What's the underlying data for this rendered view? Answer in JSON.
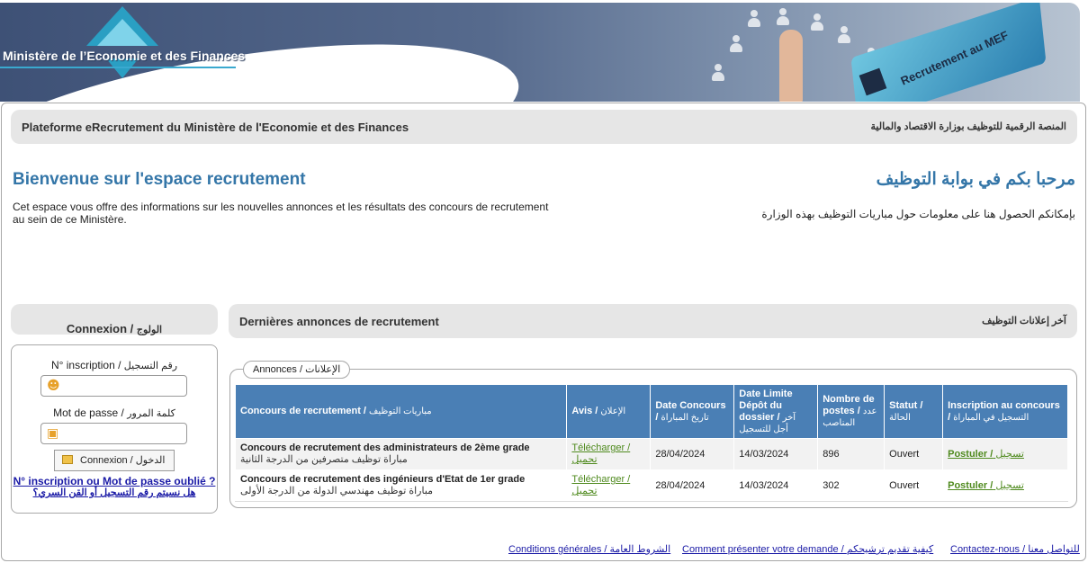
{
  "banner": {
    "ministry_name": "Ministère de l’Economie et des Finances",
    "card_text": "Recrutement au MEF"
  },
  "topbar": {
    "title_fr": "Plateforme eRecrutement du Ministère de l'Economie et des Finances",
    "title_ar": "المنصة الرقمية للتوظيف بوزارة الاقتصاد والمالية"
  },
  "welcome": {
    "title_fr": "Bienvenue sur l'espace recrutement",
    "title_ar": "مرحبا بكم في بوابة التوظيف",
    "text_fr": "Cet espace vous offre des informations sur les nouvelles annonces et les résultats des concours de recrutement au sein de ce Ministère.",
    "text_ar": "بإمكانكم الحصول هنا على معلومات حول مباريات التوظيف بهذه الوزارة"
  },
  "login": {
    "header_fr": "Connexion /",
    "header_ar": "الولوج",
    "inscription_label_fr": "N° inscription /",
    "inscription_label_ar": "رقم التسجيل",
    "inscription_value": "",
    "password_label_fr": "Mot de passe /",
    "password_label_ar": "كلمة المرور",
    "password_value": "",
    "button_fr": "Connexion /",
    "button_ar": "الدخول",
    "forgot_fr": "N° inscription ou Mot de passe oublié ?",
    "forgot_ar": "هل نسيتم رقم التسجيل أو القن السري؟",
    "user_icon": "user-icon",
    "lock_icon": "lock-icon"
  },
  "announcements": {
    "header_fr": "Dernières annonces de recrutement",
    "header_ar": "آخر إعلانات التوظيف",
    "legend": "Annonces / الإعلانات",
    "columns": [
      {
        "fr": "Concours de recrutement /",
        "ar": "مباريات التوظيف"
      },
      {
        "fr": "Avis /",
        "ar": "الإعلان"
      },
      {
        "fr": "Date Concours /",
        "ar": "تاريخ المباراة"
      },
      {
        "fr": "Date Limite Dépôt du dossier /",
        "ar": "آخر أجل للتسجيل"
      },
      {
        "fr": "Nombre de postes /",
        "ar": "عدد المناصب"
      },
      {
        "fr": "Statut /",
        "ar": "الحالة"
      },
      {
        "fr": "Inscription au concours /",
        "ar": "التسجيل في المباراة"
      }
    ],
    "rows": [
      {
        "title_fr": "Concours de recrutement des administrateurs de 2ème grade",
        "title_ar": "مباراة توظيف متصرفين من الدرجة الثانية",
        "avis_fr": "Télécharger /",
        "avis_ar": "تحميل",
        "date_concours": "28/04/2024",
        "date_limite": "14/03/2024",
        "postes": "896",
        "statut": "Ouvert",
        "inscription_fr": "Postuler /",
        "inscription_ar": "تسجيل"
      },
      {
        "title_fr": "Concours de recrutement des ingénieurs d'Etat de 1er grade",
        "title_ar": "مباراة توظيف مهندسي الدولة من الدرجة الأولى",
        "avis_fr": "Télécharger /",
        "avis_ar": "تحميل",
        "date_concours": "28/04/2024",
        "date_limite": "14/03/2024",
        "postes": "302",
        "statut": "Ouvert",
        "inscription_fr": "Postuler /",
        "inscription_ar": "تسجيل"
      }
    ]
  },
  "footer": {
    "conditions": "Conditions générales / الشروط العامة",
    "howto": "Comment présenter votre demande / كيفية تقديم ترشيحكم",
    "contact": "Contactez-nous / للتواصل معنا"
  },
  "colors": {
    "accent_blue": "#3476a8",
    "table_header": "#4a7fb5",
    "link_green": "#4f8a1e",
    "link_blue": "#1a1aa6"
  }
}
